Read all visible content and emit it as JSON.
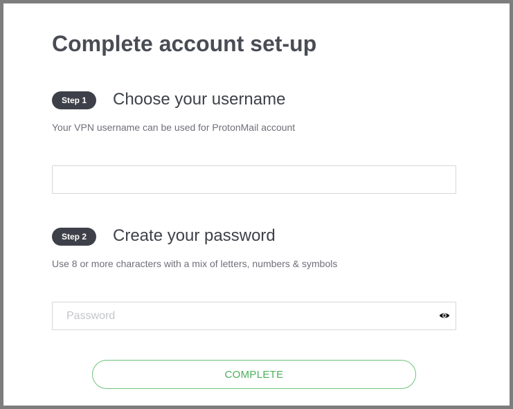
{
  "page": {
    "title": "Complete account set-up"
  },
  "step1": {
    "badge": "Step 1",
    "heading": "Choose your username",
    "hint": "Your VPN username can be used for ProtonMail account",
    "input_value": "",
    "input_placeholder": ""
  },
  "step2": {
    "badge": "Step 2",
    "heading": "Create your password",
    "hint": "Use 8 or more characters with a mix of letters, numbers & symbols",
    "input_value": "",
    "input_placeholder": "Password",
    "toggle_icon": "eye-icon"
  },
  "actions": {
    "complete_label": "COMPLETE"
  },
  "colors": {
    "title": "#4a4c55",
    "badge_bg": "#3e4049",
    "accent_green": "#4caf5a",
    "frame": "#7d7d7d"
  }
}
